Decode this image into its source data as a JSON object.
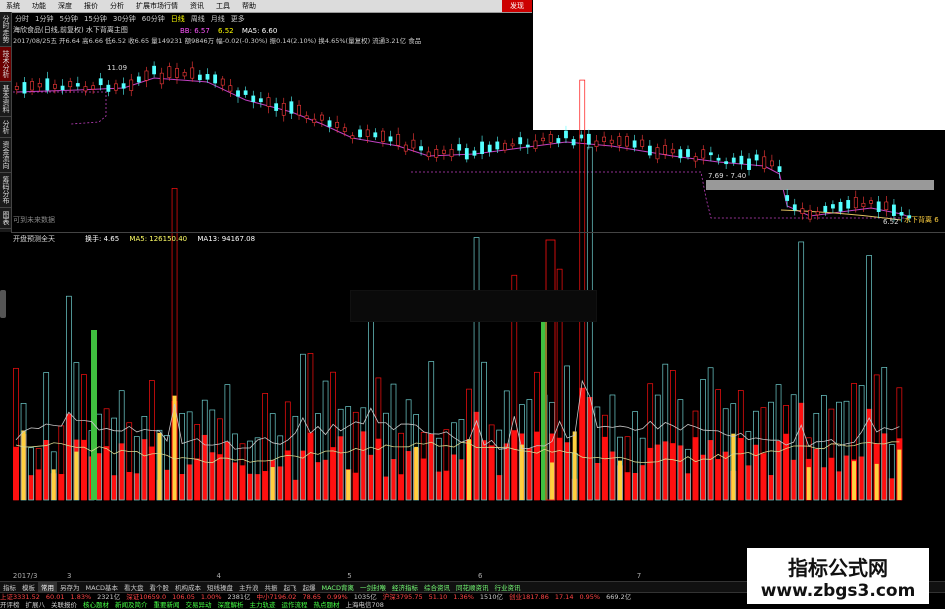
{
  "menubar": {
    "items": [
      "系统",
      "功能",
      "深度",
      "报价",
      "分析",
      "扩展市场行情",
      "资讯",
      "工具",
      "帮助"
    ],
    "highlight": "发现"
  },
  "leftbar": {
    "items": [
      {
        "label": "分时走势",
        "red": false
      },
      {
        "label": "技术分析",
        "red": true
      },
      {
        "label": "基本资料",
        "red": false
      },
      {
        "label": "分析",
        "red": false
      },
      {
        "label": "资金流向",
        "red": false
      },
      {
        "label": "筹码分布",
        "red": false
      },
      {
        "label": "图表",
        "red": false
      }
    ]
  },
  "periodbar": {
    "items": [
      "分时",
      "1分钟",
      "5分钟",
      "15分钟",
      "30分钟",
      "60分钟",
      "日线",
      "周线",
      "月线",
      "更多"
    ],
    "active_index": 6
  },
  "stock": {
    "name": "海欣食品(日线,前复权) 水下背离主图",
    "info": "2017/08/25五 开6.64 高6.66 低6.52 收6.65 量149231 额9846万 幅-0.02(-0.30%) 振0.14(2.10%) 换4.65%(量复权) 流通3.21亿 食品"
  },
  "ma_legend": {
    "items": [
      {
        "label": "BB: 6.57",
        "color": "#ff55ff"
      },
      {
        "label": "6.52",
        "color": "#ffff00"
      },
      {
        "label": "MA5: 6.60",
        "color": "#ffffff"
      }
    ]
  },
  "annotations": {
    "high_label": "11.09",
    "range_label": "7.69 - 7.40",
    "low_label": "6.52",
    "right_label": "水下背离 6",
    "nodata": "可到未来数据"
  },
  "subchart": {
    "title": "开盘预测全天",
    "legend": [
      {
        "label": "换手: 4.65",
        "color": "#ffffff"
      },
      {
        "label": "MA5: 126150.40",
        "color": "#ffff66"
      },
      {
        "label": "MA13: 94167.08",
        "color": "#ffffff"
      }
    ]
  },
  "datebar": {
    "labels": [
      {
        "text": "2017/3",
        "pos": 0.002
      },
      {
        "text": "5",
        "pos": 0.36
      },
      {
        "text": "6",
        "pos": 0.5
      },
      {
        "text": "7",
        "pos": 0.67
      },
      {
        "text": "4",
        "pos": 0.22
      },
      {
        "text": "3",
        "pos": 0.06
      }
    ]
  },
  "tabbar": {
    "items": [
      "指标",
      "模板",
      "常用",
      "另存为",
      "MACD基本",
      "看大盘",
      "看个股",
      "机构成本",
      "短线操盘",
      "主升浪",
      "共振",
      "起飞",
      "起爆",
      "MACD背离",
      "一剑封喉",
      "经济指标",
      "综合资讯",
      "同花顺资讯",
      "行业资讯"
    ],
    "active_index": 2
  },
  "statusbar": {
    "row1": [
      {
        "t": "上证3331.52",
        "c": "r"
      },
      {
        "t": "60.01",
        "c": "r"
      },
      {
        "t": "1.83%",
        "c": "r"
      },
      {
        "t": "2321亿",
        "c": ""
      },
      {
        "t": "深证10659.0",
        "c": "r"
      },
      {
        "t": "106.05",
        "c": "r"
      },
      {
        "t": "1.00%",
        "c": "r"
      },
      {
        "t": "2381亿",
        "c": ""
      },
      {
        "t": "中小7196.02",
        "c": "r"
      },
      {
        "t": "78.65",
        "c": "r"
      },
      {
        "t": "0.99%",
        "c": "r"
      },
      {
        "t": "1035亿",
        "c": ""
      },
      {
        "t": "沪深3795.75",
        "c": "r"
      },
      {
        "t": "51.10",
        "c": "r"
      },
      {
        "t": "1.36%",
        "c": "r"
      },
      {
        "t": "1510亿",
        "c": ""
      },
      {
        "t": "创业1817.86",
        "c": "r"
      },
      {
        "t": "17.14",
        "c": "r"
      },
      {
        "t": "0.95%",
        "c": "r"
      },
      {
        "t": "669.2亿",
        "c": ""
      }
    ],
    "row2": [
      {
        "t": "开评榜",
        "c": ""
      },
      {
        "t": "扩展八",
        "c": ""
      },
      {
        "t": "关联报价",
        "c": ""
      },
      {
        "t": "核心题材",
        "c": "g"
      },
      {
        "t": "新闻及简介",
        "c": "g"
      },
      {
        "t": "重要新闻",
        "c": "g"
      },
      {
        "t": "交易异动",
        "c": "g"
      },
      {
        "t": "深度解析",
        "c": "g"
      },
      {
        "t": "主力轨迹",
        "c": "g"
      },
      {
        "t": "运作流程",
        "c": "g"
      },
      {
        "t": "热点题材",
        "c": "g"
      },
      {
        "t": "上海电信708",
        "c": ""
      }
    ]
  },
  "watermark": {
    "line1": "指标公式网",
    "line2": "www.zbgs3.com"
  },
  "colors": {
    "candle_up": "#ff3b3b",
    "candle_down": "#54ffff",
    "ma_purple": "#c040c0",
    "ma_yellow": "#e0c060",
    "vol_red": "#ff1010",
    "vol_yellow": "#ffd040",
    "vol_green": "#40c040",
    "line_cyan": "#70d0d0",
    "line_white": "#c8c8c8"
  }
}
